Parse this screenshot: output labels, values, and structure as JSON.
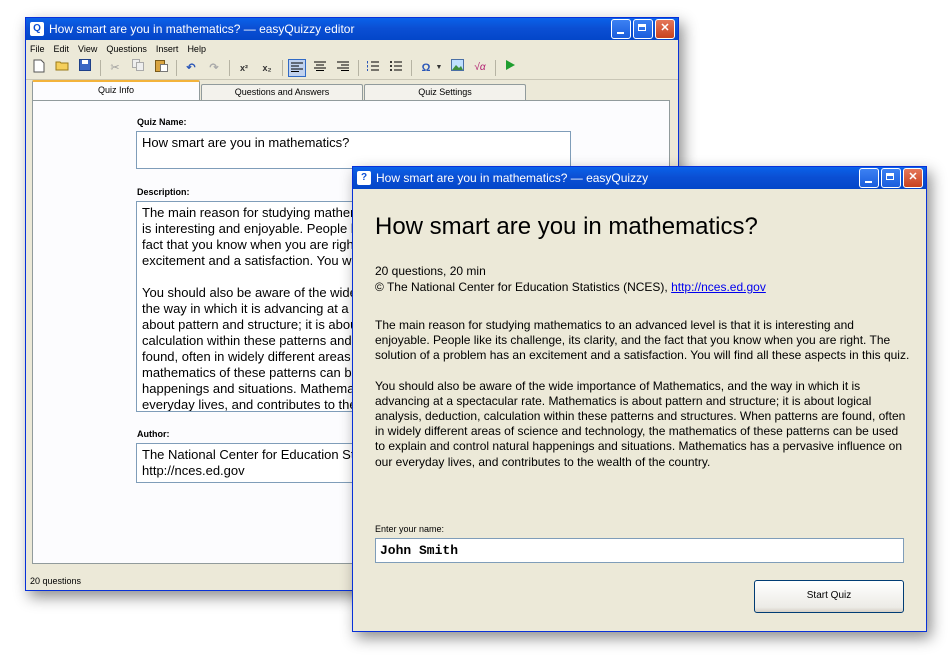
{
  "editor": {
    "title": "How smart are you in mathematics? — easyQuizzy editor",
    "app_icon": "Q",
    "menu": [
      "File",
      "Edit",
      "View",
      "Questions",
      "Insert",
      "Help"
    ],
    "tabs": [
      "Quiz Info",
      "Questions and Answers",
      "Quiz Settings"
    ],
    "quiz_name_label": "Quiz Name:",
    "quiz_name_value": "How smart are you in mathematics?",
    "description_label": "Description:",
    "description_value": "The main reason for studying mathematics to an advanced level is that it\nis interesting and enjoyable. People like its challenge, its clarity, and the\nfact that you know when you are right. The solution of a problem has an\nexcitement and a satisfaction. You will find all these aspects in this quiz.\n\nYou should also be aware of the wide importance of Mathematics, and\nthe way in which it is advancing at a spectacular rate. Mathematics is\nabout pattern and structure; it is about logical analysis, deduction,\ncalculation within these patterns and structures. When patterns are\nfound, often in widely different areas of science and technology, the\nmathematics of these patterns can be used to explain and control natural\nhappenings and situations. Mathematics has a pervasive influence on our\neveryday lives, and contributes to the wealth of the country.",
    "author_label": "Author:",
    "author_value": "The National Center for Education Statistics (NCES)\nhttp://nces.ed.gov",
    "status": "20 questions"
  },
  "quiz": {
    "title": "How smart are you in mathematics? — easyQuizzy",
    "app_icon": "?",
    "heading": "How smart are you in mathematics?",
    "meta": "20 questions, 20 min",
    "copyright": "© The National Center for Education Statistics (NCES),",
    "link": "http://nces.ed.gov",
    "paragraph1": "The main reason for studying mathematics to an advanced level is that it is interesting and enjoyable. People like its challenge, its clarity, and the fact that you know when you are right. The solution of a problem has an excitement and a satisfaction. You will find all these aspects in this quiz.",
    "paragraph2": "You should also be aware of the wide importance of Mathematics, and the way in which it is advancing at a spectacular rate. Mathematics is about pattern and structure; it is about logical analysis, deduction, calculation within these patterns and structures. When patterns are found, often in widely different areas of science and technology, the mathematics of these patterns can be used to explain and control natural happenings and situations. Mathematics has a pervasive influence on our everyday lives, and contributes to the wealth of the country.",
    "name_label": "Enter your name:",
    "name_value": "John Smith",
    "start_button": "Start Quiz"
  },
  "toolbar_icons": [
    "new-icon",
    "open-icon",
    "save-icon",
    "cut-icon",
    "copy-icon",
    "paste-icon",
    "undo-icon",
    "redo-icon",
    "superscript-icon",
    "subscript-icon",
    "align-left-icon",
    "align-center-icon",
    "align-right-icon",
    "numbered-list-icon",
    "bullet-list-icon",
    "symbol-icon",
    "image-icon",
    "formula-icon",
    "run-icon"
  ],
  "toolbar_glyphs": {
    "superscript": "x²",
    "subscript": "x₂",
    "symbol": "Ω"
  }
}
